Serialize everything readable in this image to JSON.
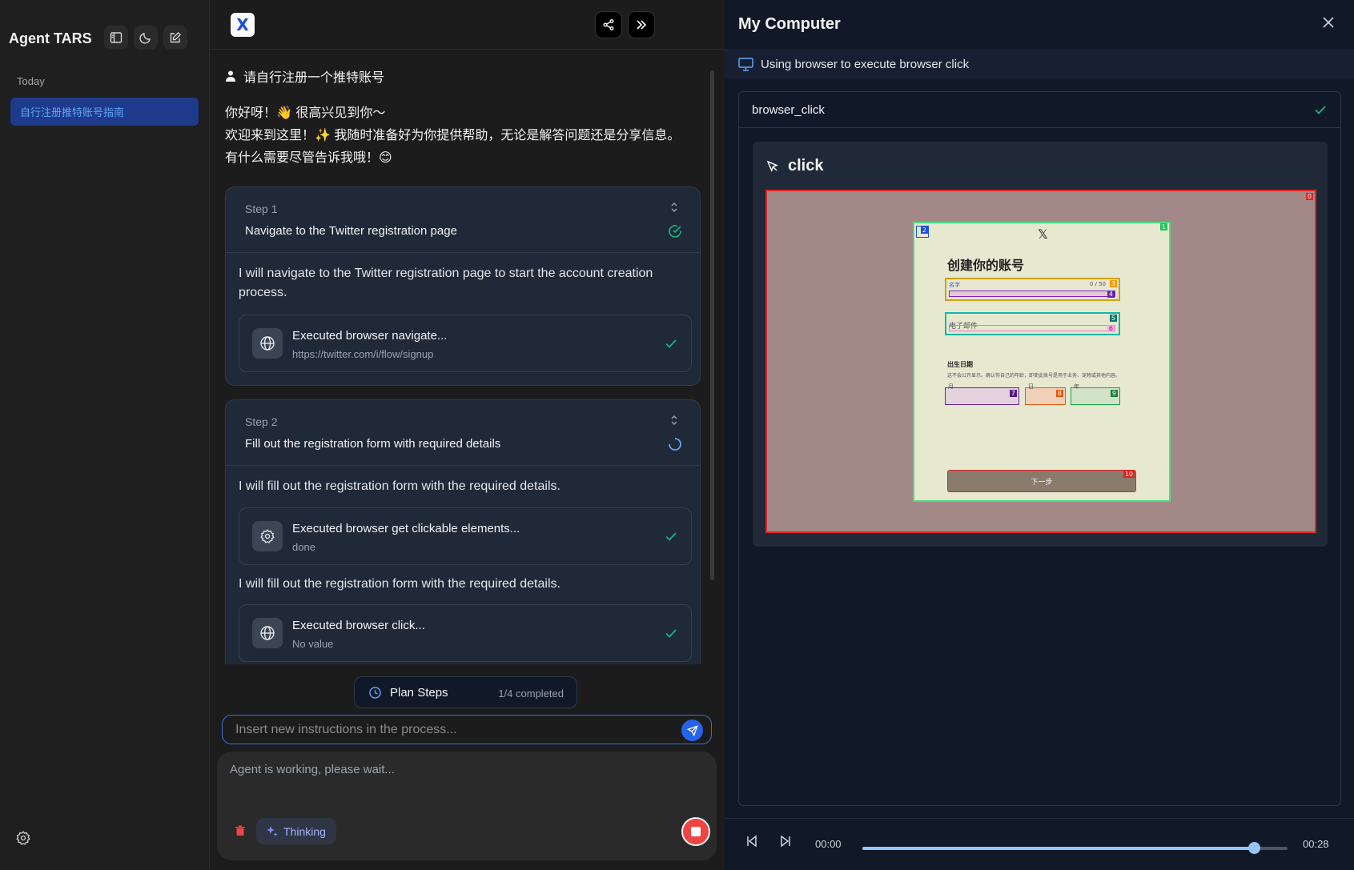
{
  "sidebar": {
    "brand": "Agent TARS",
    "section_today": "Today",
    "conversation_title": "自行注册推特账号指南"
  },
  "chat": {
    "logo_letter": "X",
    "user_message": "请自行注册一个推特账号",
    "greeting_lines": [
      "你好呀！👋 很高兴见到你～",
      "欢迎来到这里！✨ 我随时准备好为你提供帮助，无论是解答问题还是分享信息。",
      "有什么需要尽管告诉我哦！😊"
    ],
    "steps": [
      {
        "label": "Step 1",
        "title": "Navigate to the Twitter registration page",
        "status": "completed",
        "blocks": [
          {
            "type": "text",
            "text": "I will navigate to the Twitter registration page to start the account creation process."
          },
          {
            "type": "tool",
            "icon": "globe-icon",
            "title": "Executed browser navigate...",
            "subtitle": "https://twitter.com/i/flow/signup"
          }
        ]
      },
      {
        "label": "Step 2",
        "title": "Fill out the registration form with required details",
        "status": "in-progress",
        "blocks": [
          {
            "type": "text",
            "text": "I will fill out the registration form with the required details."
          },
          {
            "type": "tool",
            "icon": "gear-icon",
            "title": "Executed browser get clickable elements...",
            "subtitle": "done"
          },
          {
            "type": "text",
            "text": "I will fill out the registration form with the required details."
          },
          {
            "type": "tool",
            "icon": "globe-icon",
            "title": "Executed browser click...",
            "subtitle": "No value"
          }
        ]
      }
    ],
    "plan": {
      "label": "Plan Steps",
      "progress": "1/4 completed"
    },
    "insert_placeholder": "Insert new instructions in the process...",
    "composer_placeholder": "Agent is working, please wait...",
    "thinking_label": "Thinking"
  },
  "panel": {
    "title": "My Computer",
    "status_text": "Using browser to execute browser click",
    "tool_name": "browser_click",
    "action_title": "click",
    "screenshot": {
      "form_title": "创建你的账号",
      "name_label": "名字",
      "name_counter": "0 / 50",
      "email_label": "电子邮件",
      "dob_label": "出生日期",
      "dob_note": "这不会公开显示。确认你自己的年龄，即使此账号是用于业务、宠物或其他内容。",
      "month_label": "月",
      "day_label": "日",
      "year_label": "年",
      "next_button": "下一步",
      "tags": [
        "0",
        "1",
        "2",
        "3",
        "4",
        "5",
        "6",
        "7",
        "8",
        "9",
        "10"
      ]
    },
    "playback": {
      "current_time": "00:00",
      "total_time": "00:28",
      "progress_fraction": 0.92
    }
  },
  "colors": {
    "accent_blue": "#2563eb",
    "success_green": "#10b981",
    "danger_red": "#ef4444"
  }
}
